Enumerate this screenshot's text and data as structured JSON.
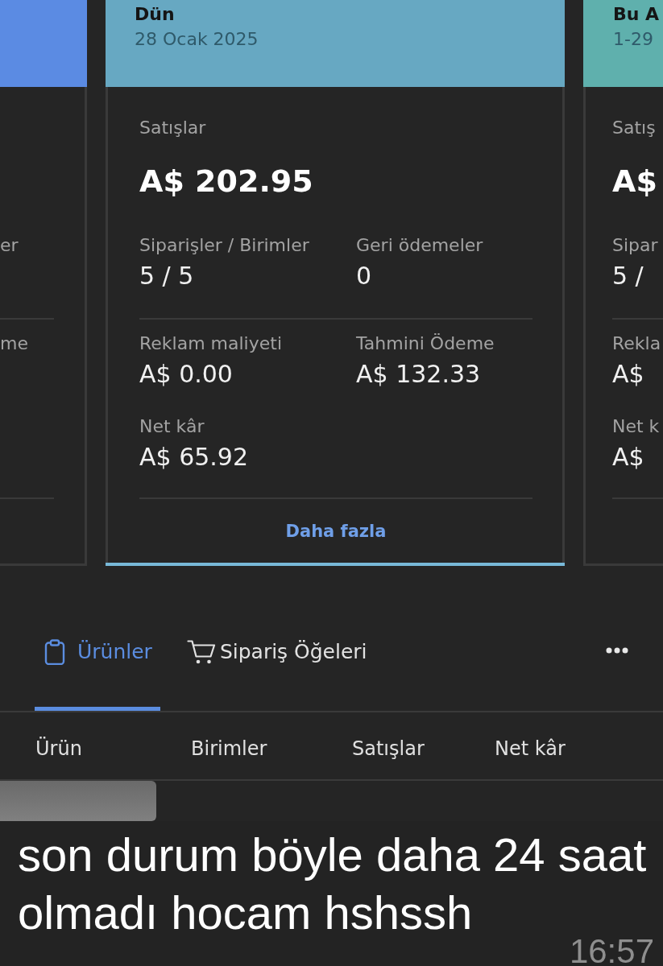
{
  "cards": [
    {
      "kind": "cut_left",
      "selected": false,
      "color": "#5b8be3",
      "groups": [
        {
          "items": [
            {
              "label": "er"
            }
          ]
        },
        {
          "items": [
            {
              "label": "me"
            }
          ]
        }
      ]
    },
    {
      "kind": "full",
      "selected": true,
      "color": "#67a8c2",
      "title": "Dün",
      "subtitle": "28 Ocak 2025",
      "headline": {
        "label": "Satışlar",
        "value": "A$ 202.95"
      },
      "groups": [
        {
          "items": [
            {
              "label": "Siparişler / Birimler",
              "value": "5 / 5"
            },
            {
              "label": "Geri ödemeler",
              "value": "0"
            }
          ]
        },
        {
          "items": [
            {
              "label": "Reklam maliyeti",
              "value": "A$ 0.00"
            },
            {
              "label": "Tahmini Ödeme",
              "value": "A$ 132.33"
            },
            {
              "label": "Net kâr",
              "value": "A$ 65.92"
            }
          ]
        }
      ],
      "link": "Daha fazla"
    },
    {
      "kind": "cut_right",
      "selected": false,
      "color": "#5fb0ad",
      "title": "Bu A",
      "subtitle": "1-29",
      "headline": {
        "label": "Satış",
        "value": "A$"
      },
      "groups": [
        {
          "items": [
            {
              "label": "Sipar",
              "value": "5 /"
            }
          ]
        },
        {
          "items": [
            {
              "label": "Rekla",
              "value": "A$"
            },
            {
              "label": "Net k",
              "value": "A$"
            }
          ]
        }
      ]
    }
  ],
  "tabs": [
    {
      "label": "Ürünler",
      "selected": true
    },
    {
      "label": "Sipariş Öğeleri",
      "selected": false
    }
  ],
  "table": {
    "columns": [
      "Ürün",
      "Birimler",
      "Satışlar",
      "Net kâr"
    ]
  },
  "message": {
    "text": "son durum böyle daha 24 saat olmadı hocam hshssh",
    "time": "16:57"
  }
}
